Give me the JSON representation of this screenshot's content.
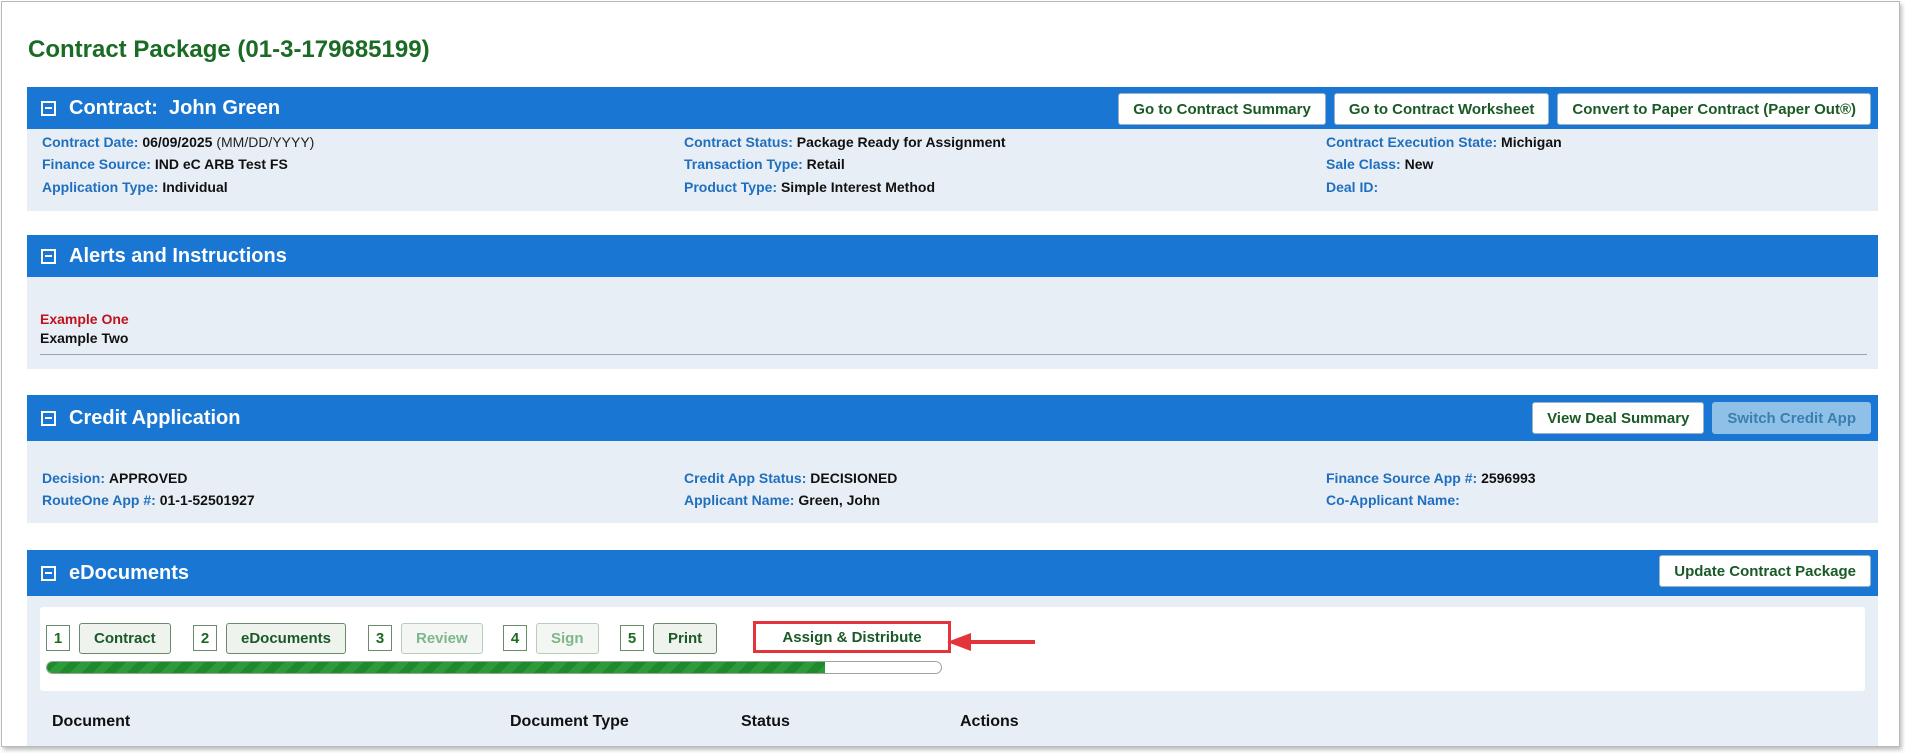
{
  "page_title": "Contract Package (01-3-179685199)",
  "contract": {
    "title": "Contract:  John Green",
    "buttons": [
      "Go to Contract Summary",
      "Go to Contract Worksheet",
      "Convert to Paper Contract (Paper Out®)"
    ],
    "contract_date_label": "Contract Date:",
    "contract_date": "06/09/2025",
    "contract_date_hint": "(MM/DD/YYYY)",
    "finance_source_label": "Finance Source:",
    "finance_source": "IND eC ARB Test FS",
    "application_type_label": "Application Type:",
    "application_type": "Individual",
    "contract_status_label": "Contract Status:",
    "contract_status": "Package Ready for Assignment",
    "transaction_type_label": "Transaction Type:",
    "transaction_type": "Retail",
    "product_type_label": "Product Type:",
    "product_type": "Simple Interest Method",
    "execution_state_label": "Contract Execution State:",
    "execution_state": "Michigan",
    "sale_class_label": "Sale Class:",
    "sale_class": "New",
    "deal_id_label": "Deal ID:",
    "deal_id": ""
  },
  "alerts": {
    "title": "Alerts and Instructions",
    "items": [
      "Example One",
      "Example Two"
    ]
  },
  "credit": {
    "title": "Credit Application",
    "buttons": [
      "View Deal Summary",
      "Switch Credit App"
    ],
    "decision_label": "Decision:",
    "decision": "APPROVED",
    "routeone_label": "RouteOne App #:",
    "routeone": "01-1-52501927",
    "status_label": "Credit App Status:",
    "status": "DECISIONED",
    "applicant_label": "Applicant Name:",
    "applicant": "Green, John",
    "fs_app_label": "Finance Source App #:",
    "fs_app": "2596993",
    "coapp_label": "Co-Applicant Name:",
    "coapp": ""
  },
  "edocs": {
    "title": "eDocuments",
    "update_button": "Update Contract Package",
    "steps": [
      {
        "num": "1",
        "label": "Contract"
      },
      {
        "num": "2",
        "label": "eDocuments"
      },
      {
        "num": "3",
        "label": "Review"
      },
      {
        "num": "4",
        "label": "Sign"
      },
      {
        "num": "5",
        "label": "Print"
      }
    ],
    "current_step": "Assign & Distribute",
    "progress": 0.87,
    "table_headers": [
      "Document",
      "Document Type",
      "Status",
      "Actions"
    ]
  },
  "colors": {
    "header_blue": "#1976d2",
    "title_green": "#1a6b24",
    "label_blue": "#1f6fbf",
    "alert_red": "#c0121b",
    "highlight_red": "#e3343b"
  }
}
